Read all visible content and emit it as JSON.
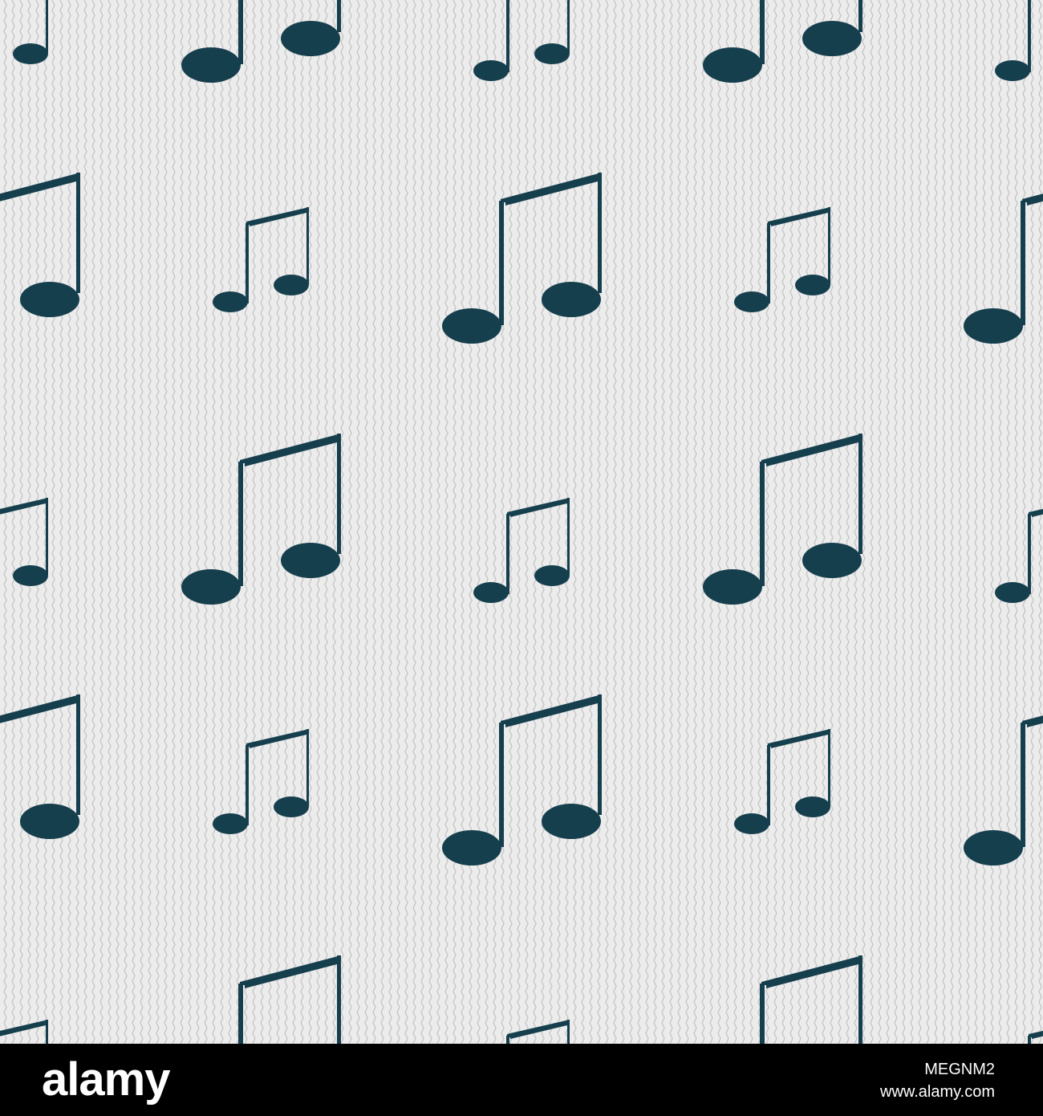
{
  "colors": {
    "background": "#ececec",
    "zigzag": "#c4c4c4",
    "note": "#163f4e",
    "footer": "#000000",
    "footer_text": "#ffffff"
  },
  "pattern": {
    "icon": "music-note-icon",
    "variants": [
      "beamed-eighth-notes-large",
      "beamed-eighth-notes-small"
    ]
  },
  "footer": {
    "logo": "alamy",
    "stock_id": "MEGNM2",
    "url": "www.alamy.com"
  }
}
